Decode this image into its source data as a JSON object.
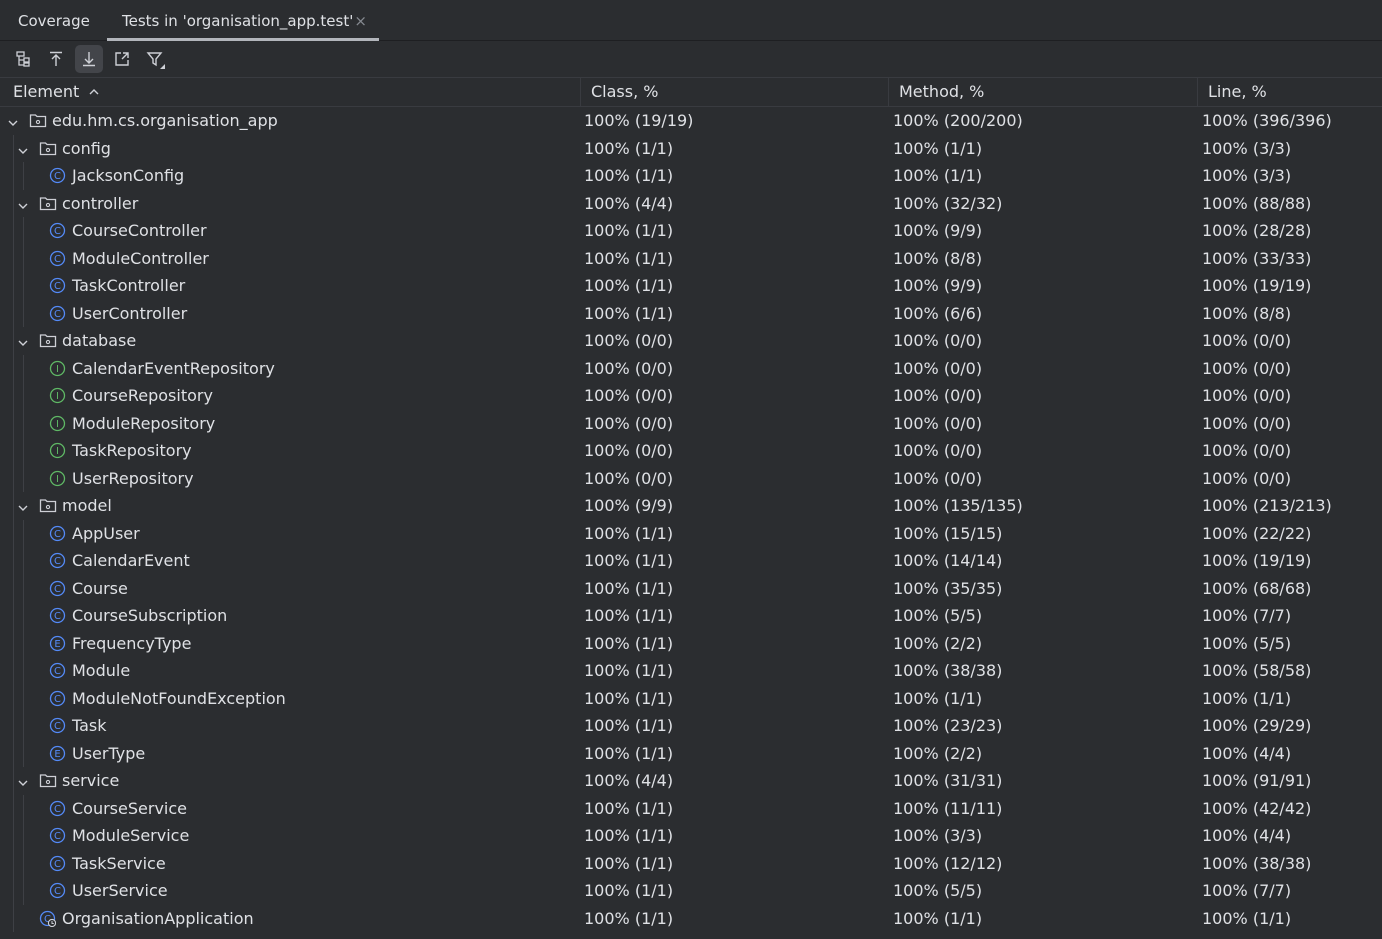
{
  "tabs": [
    {
      "label": "Coverage"
    },
    {
      "label": "Tests in 'organisation_app.test'",
      "close": "×"
    }
  ],
  "toolbar": {
    "buttons": [
      "flatten-packages-icon",
      "navigate-up-icon",
      "navigate-down-icon",
      "export-icon",
      "filter-icon"
    ]
  },
  "columns": {
    "element": "Element",
    "sort_indicator": "^",
    "class": "Class, %",
    "method": "Method, %",
    "line": "Line, %"
  },
  "rows": [
    {
      "name": "edu.hm.cs.organisation_app",
      "icon": "package",
      "level": 0,
      "expanded": true,
      "cls": "100% (19/19)",
      "method": "100% (200/200)",
      "line": "100% (396/396)"
    },
    {
      "name": "config",
      "icon": "package",
      "level": 1,
      "expanded": true,
      "cls": "100% (1/1)",
      "method": "100% (1/1)",
      "line": "100% (3/3)"
    },
    {
      "name": "JacksonConfig",
      "icon": "class",
      "level": 2,
      "cls": "100% (1/1)",
      "method": "100% (1/1)",
      "line": "100% (3/3)"
    },
    {
      "name": "controller",
      "icon": "package",
      "level": 1,
      "expanded": true,
      "cls": "100% (4/4)",
      "method": "100% (32/32)",
      "line": "100% (88/88)"
    },
    {
      "name": "CourseController",
      "icon": "class",
      "level": 2,
      "cls": "100% (1/1)",
      "method": "100% (9/9)",
      "line": "100% (28/28)"
    },
    {
      "name": "ModuleController",
      "icon": "class",
      "level": 2,
      "cls": "100% (1/1)",
      "method": "100% (8/8)",
      "line": "100% (33/33)"
    },
    {
      "name": "TaskController",
      "icon": "class",
      "level": 2,
      "cls": "100% (1/1)",
      "method": "100% (9/9)",
      "line": "100% (19/19)"
    },
    {
      "name": "UserController",
      "icon": "class",
      "level": 2,
      "cls": "100% (1/1)",
      "method": "100% (6/6)",
      "line": "100% (8/8)"
    },
    {
      "name": "database",
      "icon": "package",
      "level": 1,
      "expanded": true,
      "cls": "100% (0/0)",
      "method": "100% (0/0)",
      "line": "100% (0/0)"
    },
    {
      "name": "CalendarEventRepository",
      "icon": "interface",
      "level": 2,
      "cls": "100% (0/0)",
      "method": "100% (0/0)",
      "line": "100% (0/0)"
    },
    {
      "name": "CourseRepository",
      "icon": "interface",
      "level": 2,
      "cls": "100% (0/0)",
      "method": "100% (0/0)",
      "line": "100% (0/0)"
    },
    {
      "name": "ModuleRepository",
      "icon": "interface",
      "level": 2,
      "cls": "100% (0/0)",
      "method": "100% (0/0)",
      "line": "100% (0/0)"
    },
    {
      "name": "TaskRepository",
      "icon": "interface",
      "level": 2,
      "cls": "100% (0/0)",
      "method": "100% (0/0)",
      "line": "100% (0/0)"
    },
    {
      "name": "UserRepository",
      "icon": "interface",
      "level": 2,
      "cls": "100% (0/0)",
      "method": "100% (0/0)",
      "line": "100% (0/0)"
    },
    {
      "name": "model",
      "icon": "package",
      "level": 1,
      "expanded": true,
      "cls": "100% (9/9)",
      "method": "100% (135/135)",
      "line": "100% (213/213)"
    },
    {
      "name": "AppUser",
      "icon": "class",
      "level": 2,
      "cls": "100% (1/1)",
      "method": "100% (15/15)",
      "line": "100% (22/22)"
    },
    {
      "name": "CalendarEvent",
      "icon": "class",
      "level": 2,
      "cls": "100% (1/1)",
      "method": "100% (14/14)",
      "line": "100% (19/19)"
    },
    {
      "name": "Course",
      "icon": "class",
      "level": 2,
      "cls": "100% (1/1)",
      "method": "100% (35/35)",
      "line": "100% (68/68)"
    },
    {
      "name": "CourseSubscription",
      "icon": "class",
      "level": 2,
      "cls": "100% (1/1)",
      "method": "100% (5/5)",
      "line": "100% (7/7)"
    },
    {
      "name": "FrequencyType",
      "icon": "enum",
      "level": 2,
      "cls": "100% (1/1)",
      "method": "100% (2/2)",
      "line": "100% (5/5)"
    },
    {
      "name": "Module",
      "icon": "class",
      "level": 2,
      "cls": "100% (1/1)",
      "method": "100% (38/38)",
      "line": "100% (58/58)"
    },
    {
      "name": "ModuleNotFoundException",
      "icon": "class",
      "level": 2,
      "cls": "100% (1/1)",
      "method": "100% (1/1)",
      "line": "100% (1/1)"
    },
    {
      "name": "Task",
      "icon": "class",
      "level": 2,
      "cls": "100% (1/1)",
      "method": "100% (23/23)",
      "line": "100% (29/29)"
    },
    {
      "name": "UserType",
      "icon": "enum",
      "level": 2,
      "cls": "100% (1/1)",
      "method": "100% (2/2)",
      "line": "100% (4/4)"
    },
    {
      "name": "service",
      "icon": "package",
      "level": 1,
      "expanded": true,
      "cls": "100% (4/4)",
      "method": "100% (31/31)",
      "line": "100% (91/91)"
    },
    {
      "name": "CourseService",
      "icon": "class",
      "level": 2,
      "cls": "100% (1/1)",
      "method": "100% (11/11)",
      "line": "100% (42/42)"
    },
    {
      "name": "ModuleService",
      "icon": "class",
      "level": 2,
      "cls": "100% (1/1)",
      "method": "100% (3/3)",
      "line": "100% (4/4)"
    },
    {
      "name": "TaskService",
      "icon": "class",
      "level": 2,
      "cls": "100% (1/1)",
      "method": "100% (12/12)",
      "line": "100% (38/38)"
    },
    {
      "name": "UserService",
      "icon": "class",
      "level": 2,
      "cls": "100% (1/1)",
      "method": "100% (5/5)",
      "line": "100% (7/7)"
    },
    {
      "name": "OrganisationApplication",
      "icon": "runnable-class",
      "level": 1,
      "cls": "100% (1/1)",
      "method": "100% (1/1)",
      "line": "100% (1/1)"
    }
  ],
  "colors": {
    "background": "#2b2d30",
    "text": "#dfe1e5",
    "class_icon": "#548af7",
    "interface_icon": "#5fb865",
    "folder_icon": "#ced0d6"
  }
}
